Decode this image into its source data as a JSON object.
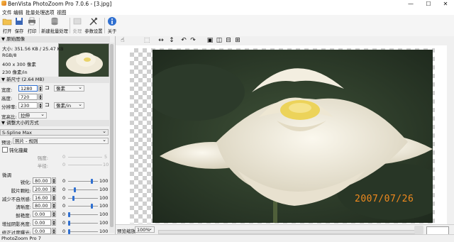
{
  "window": {
    "title": "BenVista PhotoZoom Pro 7.0.6 - [3.jpg]",
    "minimize": "—",
    "maximize": "☐",
    "close": "✕"
  },
  "menu": [
    "文件",
    "编辑",
    "批量处理",
    "选项",
    "视图"
  ],
  "toolbar": {
    "open": "打开",
    "save": "保存",
    "print": "打印",
    "new_batch": "新建批量处理",
    "process": "处理",
    "settings": "参数设置",
    "about": "关于"
  },
  "panel": {
    "original_header": "原始图像",
    "file_size": "大小: 351.56 KB / 25.47 KB",
    "color_mode": "RGB/8",
    "dimensions": "400 x 300 像素",
    "resolution": "230 像素/in",
    "newsize_header": "新尺寸 (2.64 MB)",
    "width_label": "宽度:",
    "width_value": "1280",
    "height_label": "高度:",
    "height_value": "720",
    "resolution_label": "分辨率:",
    "resolution_value": "230",
    "unit_px": "像素",
    "unit_px_in": "像素/in",
    "aspect_label": "宽高比:",
    "aspect_value": "拉伸",
    "resize_header": "调整大小的方式",
    "method": "S-Spline Max",
    "preset_label": "预设:",
    "preset_value": "照片 - 规则",
    "antialias_label": "钝化蕴藏",
    "strength_label": "强度:",
    "strength_min": "0",
    "strength_max": "5",
    "radius_label": "半径:",
    "radius_min": "0",
    "radius_max": "10",
    "finetune_header": "微调",
    "sliders": [
      {
        "label": "锐化:",
        "value": "80.00",
        "min": "0",
        "max": "100",
        "pos": 0.8
      },
      {
        "label": "胶片颗粒:",
        "value": "20.00",
        "min": "0",
        "max": "100",
        "pos": 0.2
      },
      {
        "label": "减少不自然感:",
        "value": "16.00",
        "min": "0",
        "max": "100",
        "pos": 0.16
      },
      {
        "label": "清晰度:",
        "value": "80.00",
        "min": "0",
        "max": "100",
        "pos": 0.8
      },
      {
        "label": "鲜艳度:",
        "value": "0.00",
        "min": "0",
        "max": "100",
        "pos": 0.0
      },
      {
        "label": "增加阴影亮度:",
        "value": "0.00",
        "min": "0",
        "max": "100",
        "pos": 0.0
      },
      {
        "label": "修正过度曝光:",
        "value": "0.00",
        "min": "0",
        "max": "100",
        "pos": 0.0
      }
    ]
  },
  "preview": {
    "zoom_label": "预览缩放:",
    "zoom_value": "100%",
    "date_stamp": "2007/07/26"
  },
  "status": "PhotoZoom Pro 7",
  "colors": {
    "accent": "#2f6fd0",
    "date": "#f08a1e"
  }
}
